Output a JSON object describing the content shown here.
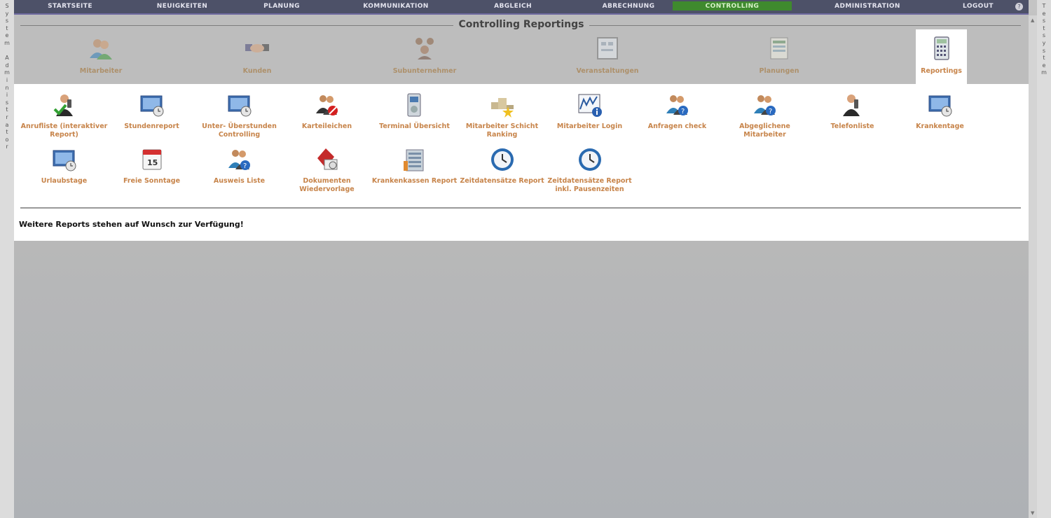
{
  "left_strip_text": "System Administrator",
  "right_strip_text": "Testsystem",
  "nav": {
    "items": [
      "STARTSEITE",
      "NEUIGKEITEN",
      "PLANUNG",
      "KOMMUNIKATION",
      "ABGLEICH",
      "ABRECHNUNG",
      "CONTROLLING",
      "ADMINISTRATION",
      "LOGOUT"
    ],
    "active": "CONTROLLING",
    "help_glyph": "?"
  },
  "page_title": "Controlling Reportings",
  "categories": [
    {
      "label": "Mitarbeiter",
      "icon": "people-icon"
    },
    {
      "label": "Kunden",
      "icon": "handshake-icon"
    },
    {
      "label": "Subunternehmer",
      "icon": "subcontractor-icon"
    },
    {
      "label": "Veranstaltungen",
      "icon": "event-board-icon"
    },
    {
      "label": "Planungen",
      "icon": "planning-sheet-icon"
    },
    {
      "label": "Reportings",
      "icon": "calculator-icon"
    }
  ],
  "selected_category": "Reportings",
  "reports_row1": [
    {
      "label": "Anrufliste (interaktiver Report)",
      "icon": "phone-user-check-icon"
    },
    {
      "label": "Stundenreport",
      "icon": "monitor-clock-icon"
    },
    {
      "label": "Unter- Überstunden Controlling",
      "icon": "monitor-clock-icon"
    },
    {
      "label": "Karteileichen",
      "icon": "users-forbidden-icon"
    },
    {
      "label": "Terminal Übersicht",
      "icon": "terminal-icon"
    },
    {
      "label": "Mitarbeiter Schicht Ranking",
      "icon": "ranking-star-icon"
    },
    {
      "label": "Mitarbeiter Login",
      "icon": "chart-info-icon"
    },
    {
      "label": "Anfragen check",
      "icon": "users-question-icon"
    },
    {
      "label": "Abgeglichene Mitarbeiter",
      "icon": "users-question-icon"
    },
    {
      "label": "Telefonliste",
      "icon": "phone-user-icon"
    },
    {
      "label": "Krankentage",
      "icon": "monitor-clock-icon"
    }
  ],
  "reports_row2": [
    {
      "label": "Urlaubstage",
      "icon": "monitor-clock-icon"
    },
    {
      "label": "Freie Sonntage",
      "icon": "calendar-15-icon"
    },
    {
      "label": "Ausweis Liste",
      "icon": "users-question-icon"
    },
    {
      "label": "Dokumenten Wiedervorlage",
      "icon": "documents-icon"
    },
    {
      "label": "Krankenkassen Report",
      "icon": "building-icon"
    },
    {
      "label": "Zeitdatensätze Report",
      "icon": "clock-report-icon"
    },
    {
      "label": "Zeitdatensätze Report inkl. Pausenzeiten",
      "icon": "clock-report-icon"
    }
  ],
  "footnote": "Weitere Reports stehen auf Wunsch zur Verfügung!",
  "colors": {
    "nav_bg": "#4d5168",
    "active_bg": "#3f8a2e",
    "label": "#c7844a"
  }
}
